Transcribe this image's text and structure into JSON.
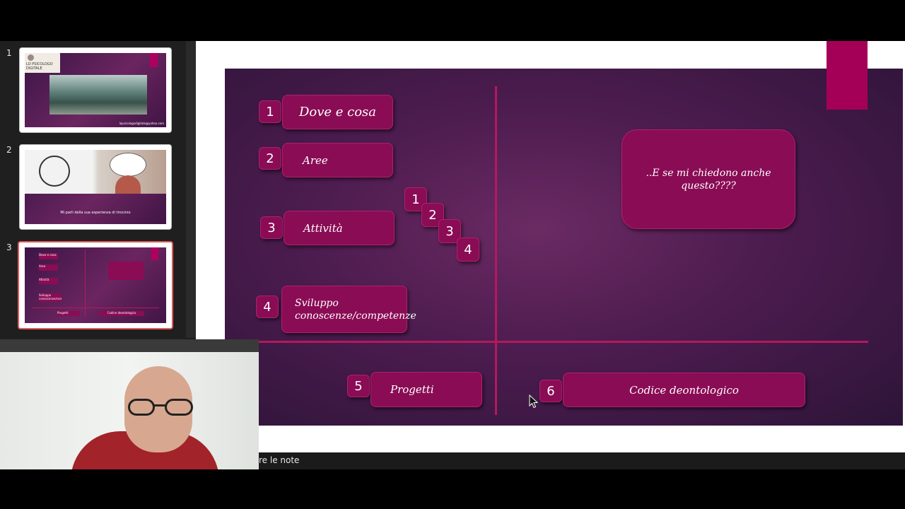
{
  "thumbnails": [
    {
      "number": "1",
      "title": "LO PSICOLOGO DIGITALE",
      "email": "lopsicologodigitale@yahoo.com"
    },
    {
      "number": "2",
      "caption": "Mi parli della sua esperienza di tirocinio"
    },
    {
      "number": "3",
      "items": [
        "Dove e cosa",
        "Aree",
        "Attività",
        "Sviluppo conoscenze/competenze",
        "Progetti",
        "Codice deontologico"
      ]
    }
  ],
  "slide": {
    "items": [
      {
        "num": "1",
        "label": "Dove e cosa"
      },
      {
        "num": "2",
        "label": "Aree"
      },
      {
        "num": "3",
        "label": "Attività"
      },
      {
        "num": "4",
        "label": "Sviluppo conoscenze/competenze"
      },
      {
        "num": "5",
        "label": "Progetti"
      },
      {
        "num": "6",
        "label": "Codice deontologico"
      }
    ],
    "steps": [
      "1",
      "2",
      "3",
      "4"
    ],
    "question": "..E se mi chiedono anche questo????"
  },
  "statusbar": {
    "notes_label": "re le note"
  },
  "colors": {
    "slide_bg": "#4c1c4f",
    "box": "#8a0c55",
    "accent": "#a50057",
    "selected_border": "#e05a5a"
  }
}
